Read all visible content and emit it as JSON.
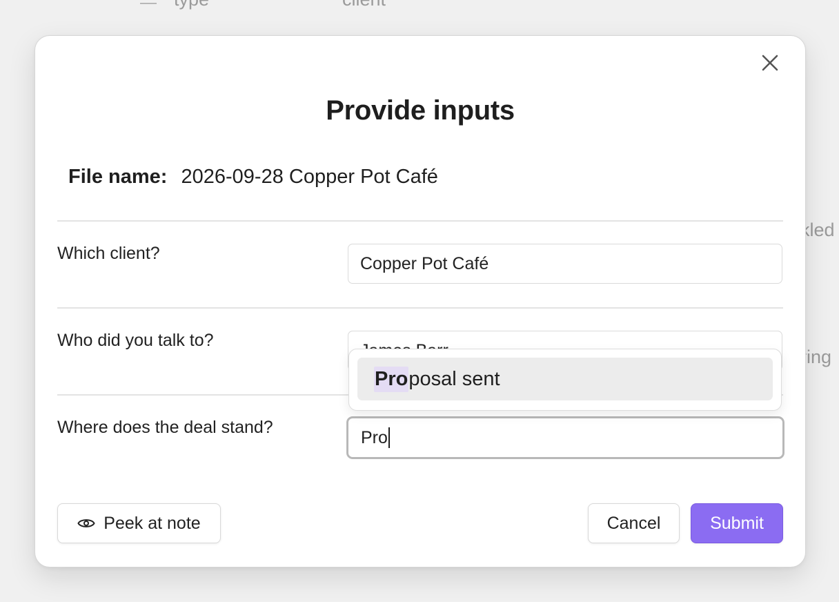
{
  "background": {
    "property_type_label": "type",
    "property_value": "client",
    "partial_right_text_1": "kled",
    "partial_right_text_2": "ring",
    "menu_icon": "menu-lines-icon"
  },
  "modal": {
    "title": "Provide inputs",
    "close_icon": "close-icon",
    "file_name_label": "File name:",
    "file_name_value": "2026-09-28 Copper Pot Café",
    "fields": [
      {
        "label": "Which client?",
        "value": "Copper Pot Café"
      },
      {
        "label": "Who did you talk to?",
        "value": "James Barr"
      },
      {
        "label": "Where does the deal stand?",
        "value": "Pro"
      }
    ],
    "suggestion": {
      "match": "Pro",
      "rest": "posal sent"
    },
    "buttons": {
      "peek_label": "Peek at note",
      "peek_icon": "eye-icon",
      "cancel_label": "Cancel",
      "submit_label": "Submit"
    },
    "colors": {
      "accent": "#8b6cf2",
      "highlight": "#e4dcf4"
    }
  }
}
